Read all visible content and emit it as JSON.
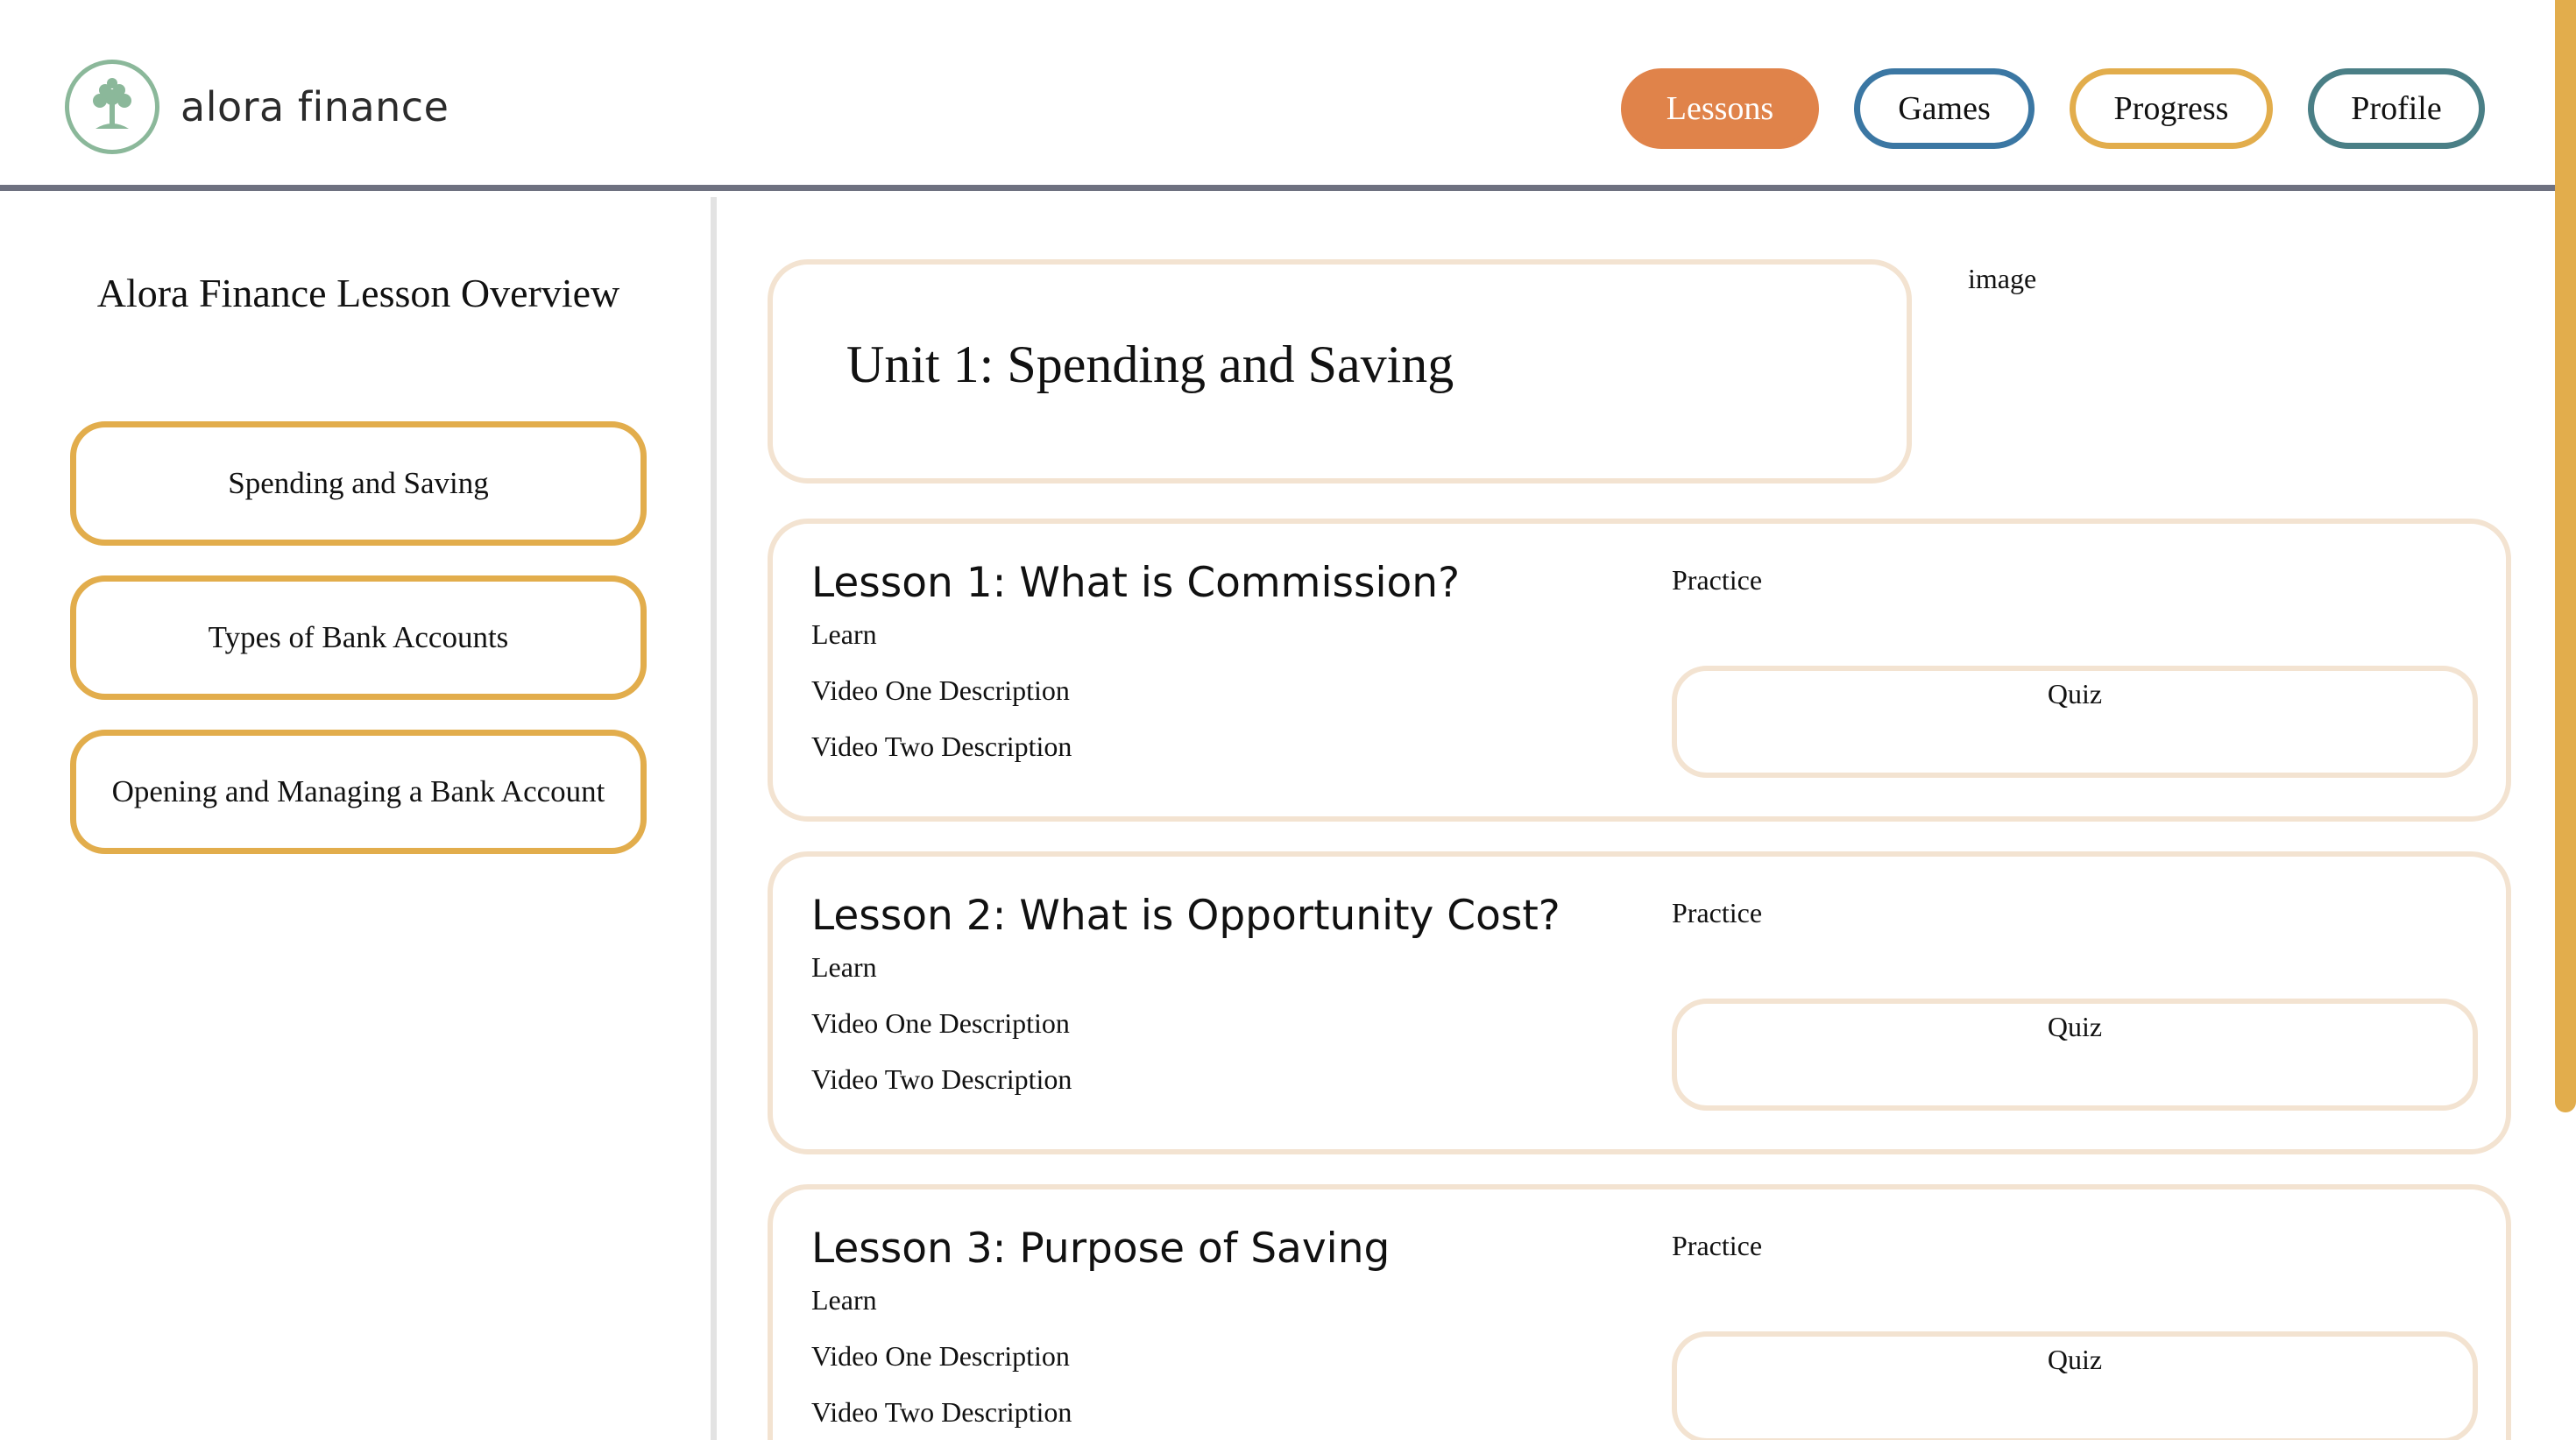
{
  "header": {
    "brand_name": "alora finance",
    "nav": {
      "lessons": "Lessons",
      "games": "Games",
      "progress": "Progress",
      "profile": "Profile"
    }
  },
  "sidebar": {
    "title": "Alora Finance Lesson Overview",
    "items": [
      {
        "label": "Spending and Saving"
      },
      {
        "label": "Types of Bank Accounts"
      },
      {
        "label": "Opening and Managing a Bank Account"
      }
    ]
  },
  "main": {
    "unit_title": "Unit 1: Spending and Saving",
    "image_alt": "image",
    "lessons": [
      {
        "title": "Lesson 1: What is Commission?",
        "learn": "Learn",
        "video_one": "Video One Description",
        "video_two": "Video Two Description",
        "practice": "Practice",
        "quiz": "Quiz"
      },
      {
        "title": "Lesson 2: What is Opportunity Cost?",
        "learn": "Learn",
        "video_one": "Video One Description",
        "video_two": "Video Two Description",
        "practice": "Practice",
        "quiz": "Quiz"
      },
      {
        "title": "Lesson 3: Purpose of Saving",
        "learn": "Learn",
        "video_one": "Video One Description",
        "video_two": "Video Two Description",
        "practice": "Practice",
        "quiz": "Quiz"
      }
    ]
  },
  "colors": {
    "lessons_nav": "#e0834a",
    "games_nav": "#3b77a3",
    "progress_nav": "#e2ad4c",
    "profile_nav": "#4a7f86",
    "sidebar_button_border": "#e2ad4c",
    "card_border": "#f3e3d1",
    "header_rule": "#6e7180",
    "logo_green": "#8bb89a"
  },
  "icons": {
    "logo": "tree-logo-icon"
  }
}
